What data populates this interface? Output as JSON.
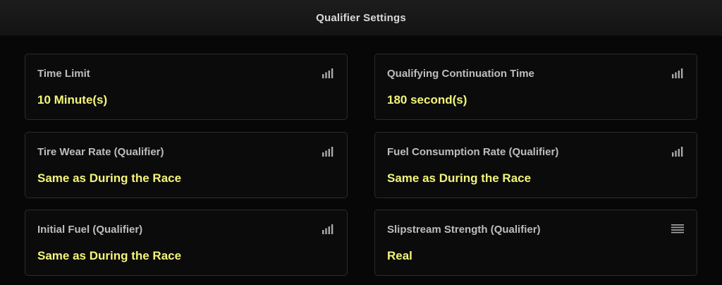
{
  "header": {
    "title": "Qualifier Settings"
  },
  "settings": [
    {
      "label": "Time Limit",
      "value": "10 Minute(s)",
      "icon": "signal-bars-icon"
    },
    {
      "label": "Qualifying Continuation Time",
      "value": "180 second(s)",
      "icon": "signal-bars-icon"
    },
    {
      "label": "Tire Wear Rate (Qualifier)",
      "value": "Same as During the Race",
      "icon": "signal-bars-icon"
    },
    {
      "label": "Fuel Consumption Rate (Qualifier)",
      "value": "Same as During the Race",
      "icon": "signal-bars-icon"
    },
    {
      "label": "Initial Fuel (Qualifier)",
      "value": "Same as During the Race",
      "icon": "signal-bars-icon"
    },
    {
      "label": "Slipstream Strength (Qualifier)",
      "value": "Real",
      "icon": "list-icon"
    }
  ],
  "colors": {
    "background": "#070707",
    "header": "#181818",
    "panel_border": "#2b2b2b",
    "label": "#bdbdbd",
    "value_accent": "#f3f57a"
  }
}
